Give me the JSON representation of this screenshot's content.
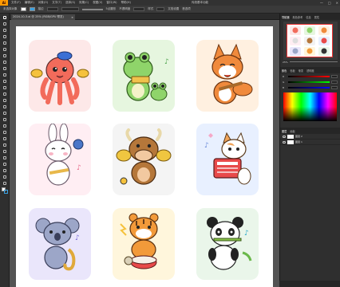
{
  "menubar": {
    "logo": "Ai",
    "items": [
      "文件(F)",
      "编辑(E)",
      "对象(O)",
      "文字(T)",
      "选择(S)",
      "效果(C)",
      "视图(V)",
      "窗口(W)",
      "帮助(H)"
    ],
    "workspace": "传统基本功能",
    "window_controls": [
      "—",
      "□",
      "×"
    ]
  },
  "control_bar": {
    "label_obj": "未选择对象",
    "stroke_label": "描边",
    "opacity_label": "不透明度",
    "style_label": "样式",
    "doc_settings": "文档设置",
    "prefs": "首选项",
    "brush_pt": "5点圆形"
  },
  "document_tab": {
    "title": "2024-10-3.ai @ 25% (RGB/GPU 预览)",
    "close": "×"
  },
  "tiles": [
    {
      "bg": "#fde8e8",
      "character": "octopus-icon"
    },
    {
      "bg": "#e6f6df",
      "character": "frog-icon"
    },
    {
      "bg": "#fff0e0",
      "character": "fox-icon"
    },
    {
      "bg": "#ffeef3",
      "character": "rabbit-icon"
    },
    {
      "bg": "#f2f2f2",
      "character": "bull-icon"
    },
    {
      "bg": "#e8f0ff",
      "character": "cat-icon"
    },
    {
      "bg": "#eae6fb",
      "character": "koala-icon"
    },
    {
      "bg": "#fff6dc",
      "character": "tiger-icon"
    },
    {
      "bg": "#eaf6ea",
      "character": "panda-icon"
    }
  ],
  "right_panel": {
    "tabs": [
      "导航器",
      "颜色参考",
      "信息",
      "属性"
    ],
    "zoom": "25%",
    "color_tabs": [
      "颜色",
      "色板",
      "渐变",
      "透明度"
    ],
    "channels": [
      "R",
      "G",
      "B"
    ],
    "layers_tabs": [
      "图层",
      "画板"
    ],
    "layers": [
      "图层 2",
      "图层 1"
    ]
  }
}
